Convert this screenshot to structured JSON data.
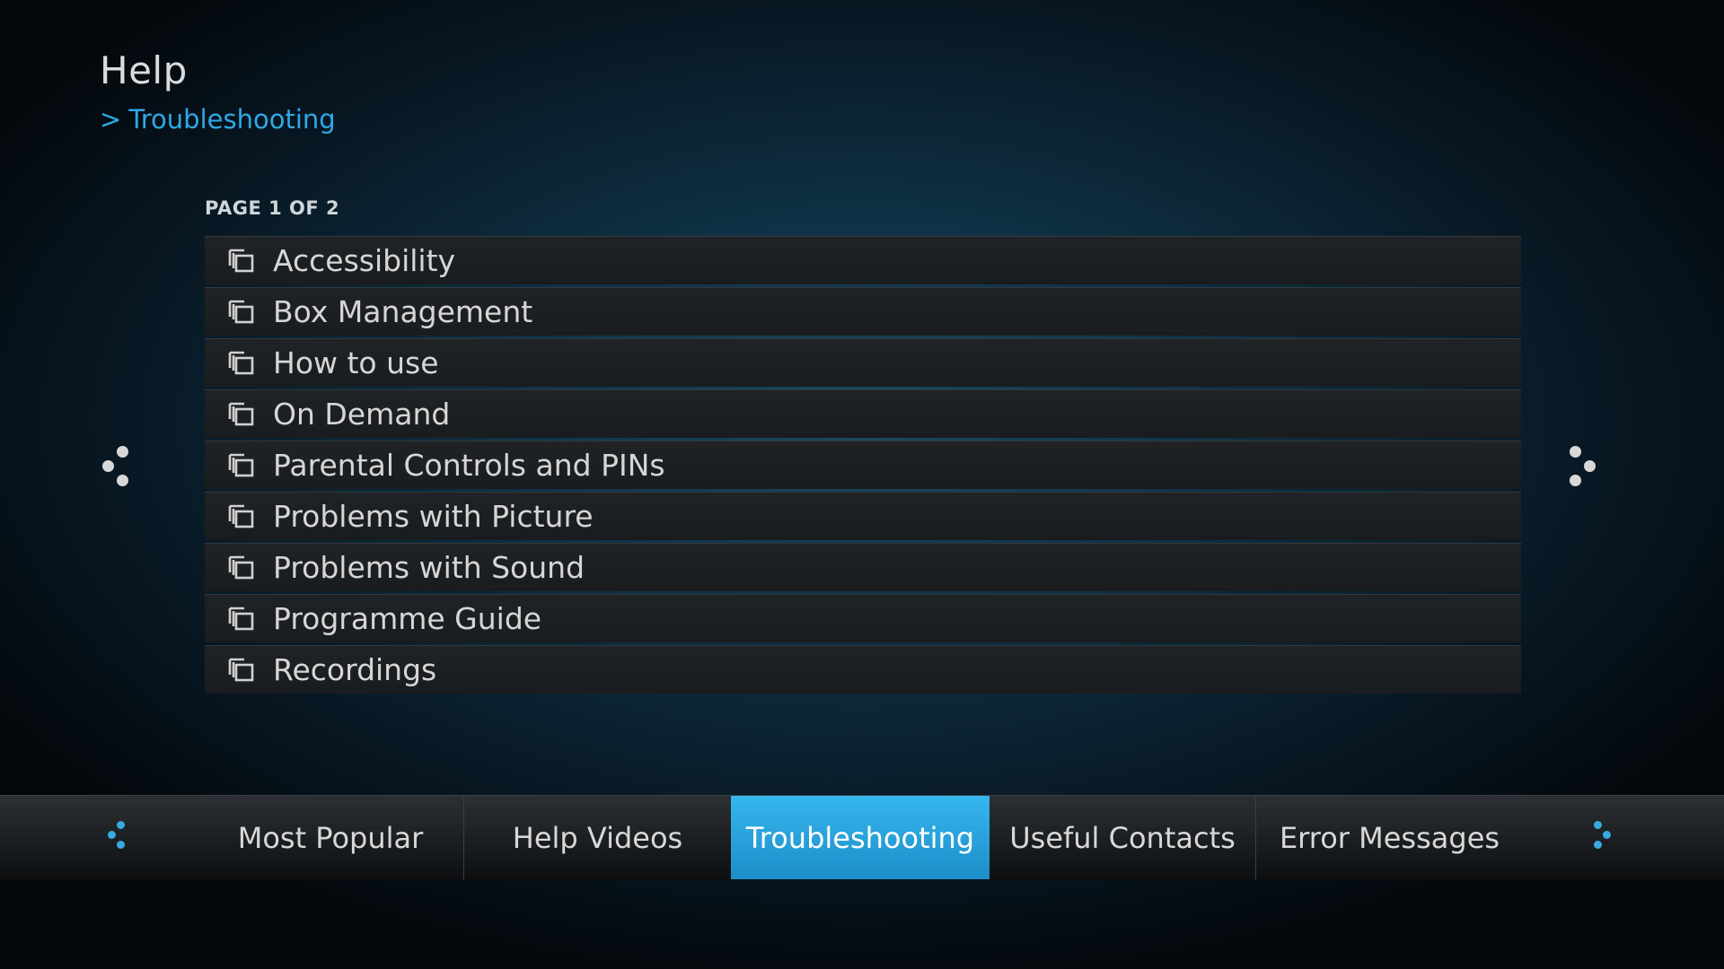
{
  "header": {
    "title": "Help",
    "breadcrumb_arrow": ">",
    "breadcrumb": "Troubleshooting"
  },
  "pagination": {
    "label": "PAGE 1 OF 2"
  },
  "list": {
    "items": [
      {
        "label": "Accessibility",
        "icon": "folder-stack-icon"
      },
      {
        "label": "Box Management",
        "icon": "folder-stack-icon"
      },
      {
        "label": "How to use",
        "icon": "folder-stack-icon"
      },
      {
        "label": "On Demand",
        "icon": "folder-stack-icon"
      },
      {
        "label": "Parental Controls and PINs",
        "icon": "folder-stack-icon"
      },
      {
        "label": "Problems with Picture",
        "icon": "folder-stack-icon"
      },
      {
        "label": "Problems with Sound",
        "icon": "folder-stack-icon"
      },
      {
        "label": "Programme Guide",
        "icon": "folder-stack-icon"
      },
      {
        "label": "Recordings",
        "icon": "folder-stack-icon"
      }
    ]
  },
  "tabs": [
    {
      "label": "Most Popular",
      "active": false
    },
    {
      "label": "Help Videos",
      "active": false
    },
    {
      "label": "Troubleshooting",
      "active": true
    },
    {
      "label": "Useful Contacts",
      "active": false
    },
    {
      "label": "Error Messages",
      "active": false
    }
  ],
  "colors": {
    "accent": "#2fa8e6",
    "active_tab": "#2aa3dd",
    "text": "#d6d6d6"
  }
}
